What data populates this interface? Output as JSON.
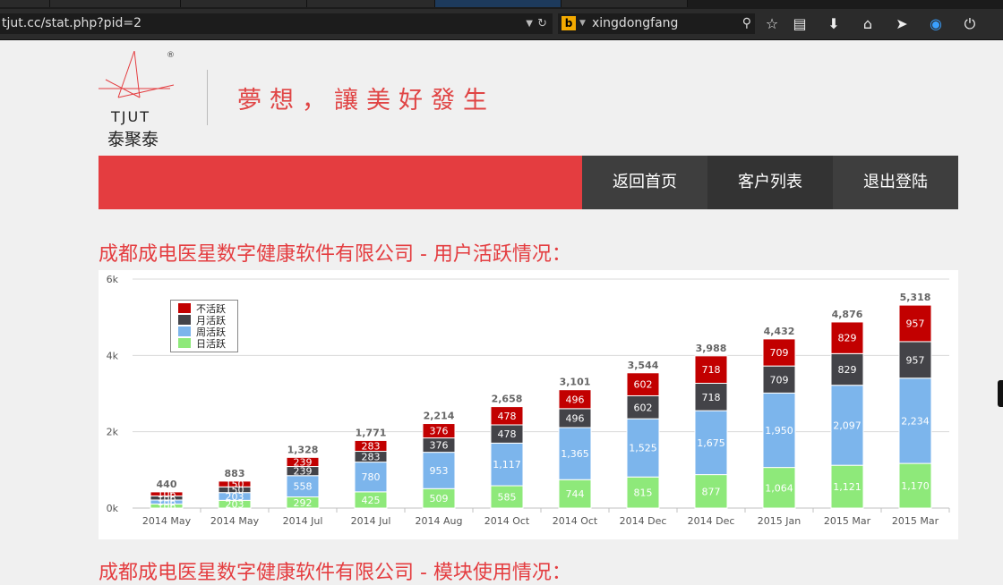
{
  "browser": {
    "url": "tjut.cc/stat.php?pid=2",
    "search_engine_icon": "b",
    "search_query": "xingdongfang",
    "toolbar_icons": [
      "magnifier-icon",
      "star-icon",
      "clipboard-icon",
      "download-icon",
      "home-icon",
      "send-icon",
      "sync-icon",
      "power-icon"
    ]
  },
  "header": {
    "logo_text": "TJUT",
    "logo_cn": "泰聚泰",
    "logo_mark": "®",
    "slogan": "夢想，讓美好發生"
  },
  "nav": {
    "items": [
      "返回首页",
      "客户列表",
      "退出登陆"
    ],
    "accent": "#e43d40",
    "dark": "#3a3a3a"
  },
  "sections": {
    "activity_title": "成都成电医星数字健康软件有限公司 - 用户活跃情况：",
    "module_title": "成都成电医星数字健康软件有限公司 - 模块使用情况："
  },
  "chart_data": {
    "type": "bar",
    "stacked": true,
    "categories": [
      "2014 May",
      "2014 May",
      "2014 Jul",
      "2014 Jul",
      "2014 Aug",
      "2014 Oct",
      "2014 Oct",
      "2014 Dec",
      "2014 Dec",
      "2015 Jan",
      "2015 Mar",
      "2015 Mar"
    ],
    "series": [
      {
        "name": "日活跃",
        "color": "#8ee97a",
        "values": [
          106,
          203,
          292,
          425,
          509,
          585,
          744,
          815,
          877,
          1064,
          1121,
          1170
        ]
      },
      {
        "name": "周活跃",
        "color": "#7cb5ec",
        "values": [
          106,
          203,
          558,
          780,
          953,
          1117,
          1365,
          1525,
          1675,
          1950,
          2097,
          2234
        ]
      },
      {
        "name": "月活跃",
        "color": "#434348",
        "values": [
          106,
          150,
          239,
          283,
          376,
          478,
          496,
          602,
          718,
          709,
          829,
          957
        ]
      },
      {
        "name": "不活跃",
        "color": "#c20000",
        "values": [
          106,
          150,
          239,
          283,
          376,
          478,
          496,
          602,
          718,
          709,
          829,
          957
        ]
      }
    ],
    "totals": [
      "440",
      "883",
      "1,328",
      "1,771",
      "2,214",
      "2,658",
      "3,101",
      "3,544",
      "3,988",
      "4,432",
      "4,876",
      "5,318"
    ],
    "y_ticks": [
      "0k",
      "2k",
      "4k",
      "6k"
    ],
    "ylim": [
      0,
      6000
    ],
    "grid": true,
    "legend_position": "top-left"
  }
}
